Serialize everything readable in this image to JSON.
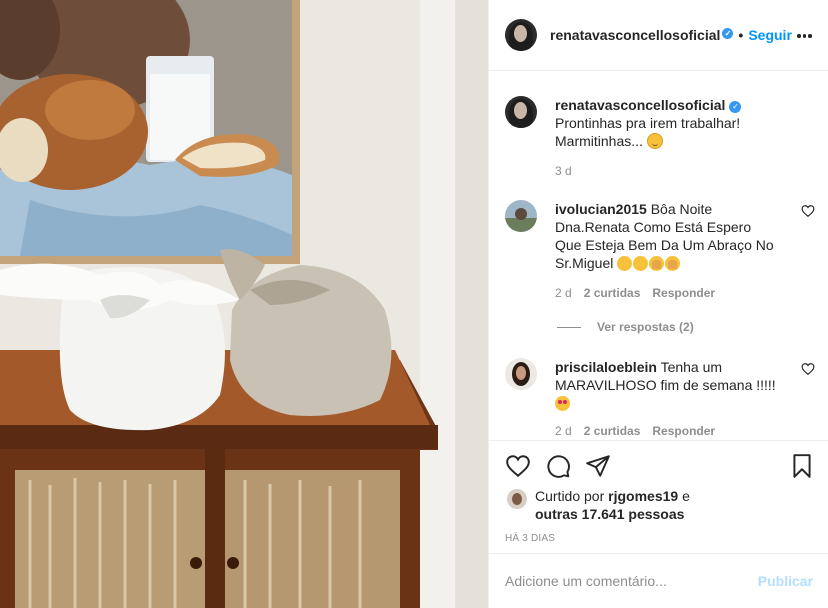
{
  "post": {
    "username": "renatavasconcellosoficial",
    "verified_mark": "✓",
    "separator": "•",
    "follow_label": "Seguir"
  },
  "caption": {
    "username": "renatavasconcellosoficial",
    "text": "Prontinhas pra irem trabalhar! Marmitinhas...",
    "time": "3 d"
  },
  "comments": [
    {
      "username": "ivolucian2015",
      "text": "Bôa Noite Dna.Renata Como Está Espero Que Esteja Bem Da Um Abraço No Sr.Miguel",
      "time": "2 d",
      "likes": "2 curtidas",
      "reply": "Responder",
      "view_replies": "Ver respostas (2)"
    },
    {
      "username": "priscilaloeblein",
      "text": "Tenha um MARAVILHOSO fim de semana !!!!!",
      "time": "2 d",
      "likes": "2 curtidas",
      "reply": "Responder"
    }
  ],
  "likes": {
    "prefix": "Curtido por",
    "user": "rjgomes19",
    "mid": "e",
    "others": "outras 17.641 pessoas"
  },
  "timestamp": "HÁ 3 DIAS",
  "add_comment": {
    "placeholder": "Adicione um comentário...",
    "publish": "Publicar"
  },
  "icons": {
    "more": "more-icon",
    "like": "heart-icon",
    "comment": "comment-icon",
    "share": "share-icon",
    "save": "bookmark-icon"
  },
  "colors": {
    "link_blue": "#0095f6",
    "verified_blue": "#3897f0",
    "muted": "#8e8e8e",
    "publish_disabled": "#b2dffc"
  }
}
